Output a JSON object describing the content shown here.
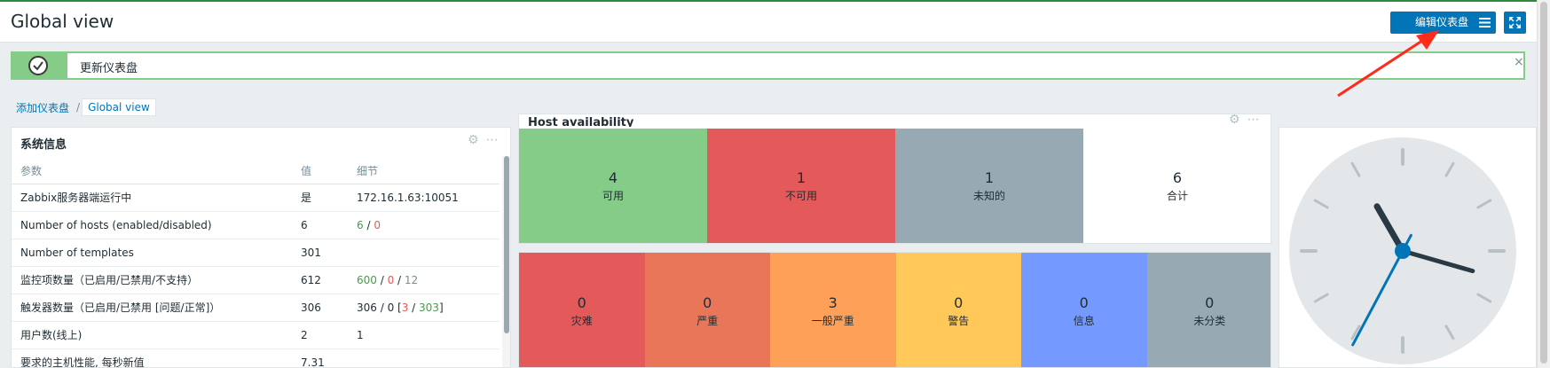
{
  "header": {
    "title": "Global view",
    "edit_dashboard_label": "编辑仪表盘",
    "menu_icon": "menu-icon",
    "fullscreen_icon": "fullscreen-icon"
  },
  "message": {
    "text": "更新仪表盘",
    "icon": "check-icon",
    "close": "×"
  },
  "breadcrumb": {
    "items": [
      "添加仪表盘",
      "Global view"
    ],
    "separator": "/"
  },
  "system_info": {
    "title": "系统信息",
    "columns": [
      "参数",
      "值",
      "细节"
    ],
    "rows": [
      {
        "param": "Zabbix服务器端运行中",
        "value": "是",
        "detail": "172.16.1.63:10051"
      },
      {
        "param": "Number of hosts (enabled/disabled)",
        "value": "6",
        "detail_a": "6",
        "detail_sep": " / ",
        "detail_b": "0"
      },
      {
        "param": "Number of templates",
        "value": "301",
        "detail": ""
      },
      {
        "param": "监控项数量（已启用/已禁用/不支持）",
        "value": "612",
        "detail_a": "600",
        "detail_sep1": " / ",
        "detail_b": "0",
        "detail_sep2": " / ",
        "detail_c": "12"
      },
      {
        "param": "触发器数量（已启用/已禁用 [问题/正常]）",
        "value": "306",
        "detail_a": "306 / 0 [",
        "detail_b": "3",
        "detail_sep": " / ",
        "detail_c": "303",
        "detail_end": "]"
      },
      {
        "param": "用户数(线上)",
        "value": "2",
        "detail": "1"
      },
      {
        "param": "要求的主机性能, 每秒新值",
        "value": "7.31",
        "detail": ""
      }
    ]
  },
  "host_availability": {
    "title": "Host availability",
    "cells": [
      {
        "num": "4",
        "label": "可用",
        "color": "#86cc89"
      },
      {
        "num": "1",
        "label": "不可用",
        "color": "#e45959"
      },
      {
        "num": "1",
        "label": "未知的",
        "color": "#97aab3"
      },
      {
        "num": "6",
        "label": "合计",
        "color": "#ffffff"
      }
    ]
  },
  "triggers": {
    "cells": [
      {
        "num": "0",
        "label": "灾难",
        "color": "#e45959"
      },
      {
        "num": "0",
        "label": "严重",
        "color": "#e97659"
      },
      {
        "num": "3",
        "label": "一般严重",
        "color": "#ffa059"
      },
      {
        "num": "0",
        "label": "警告",
        "color": "#ffc859"
      },
      {
        "num": "0",
        "label": "信息",
        "color": "#7499ff"
      },
      {
        "num": "0",
        "label": "未分类",
        "color": "#97aab3"
      }
    ]
  },
  "clock": {
    "hour_hand_angle_deg": 330,
    "minute_hand_angle_deg": 106,
    "second_hand_angle_deg": 208
  },
  "colors": {
    "accent": "#0275b8",
    "success": "#86cc89",
    "annotation": "#ff2a1a"
  }
}
